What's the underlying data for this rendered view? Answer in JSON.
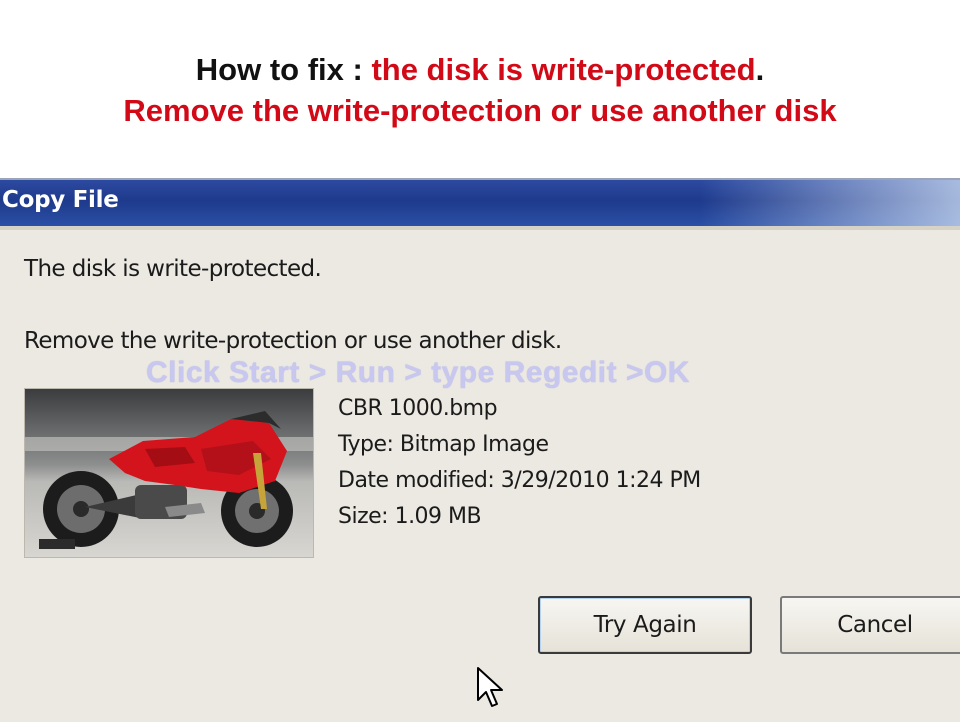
{
  "banner": {
    "prefix": "How to fix : ",
    "line1_red": "the disk is write-protected",
    "line1_end": ".",
    "line2": "Remove the write-protection or use another disk"
  },
  "dialog": {
    "title": "Copy File",
    "message1": "The disk is write-protected.",
    "message2": "Remove the write-protection or use another disk.",
    "overlay": "Click   Start > Run > type  Regedit >OK",
    "file": {
      "name": "CBR 1000.bmp",
      "type": "Type: Bitmap Image",
      "modified": "Date modified: 3/29/2010 1:24 PM",
      "size": "Size: 1.09 MB"
    },
    "buttons": {
      "try_again": "Try Again",
      "cancel": "Cancel"
    },
    "thumbnail_icon": "motorcycle-thumbnail",
    "cursor_icon": "mouse-pointer-icon"
  },
  "colors": {
    "banner_red": "#d20a17",
    "titlebar_blue": "#1e3a8c",
    "dialog_bg": "#ece9e2",
    "overlay_text": "#c7c7ef"
  }
}
